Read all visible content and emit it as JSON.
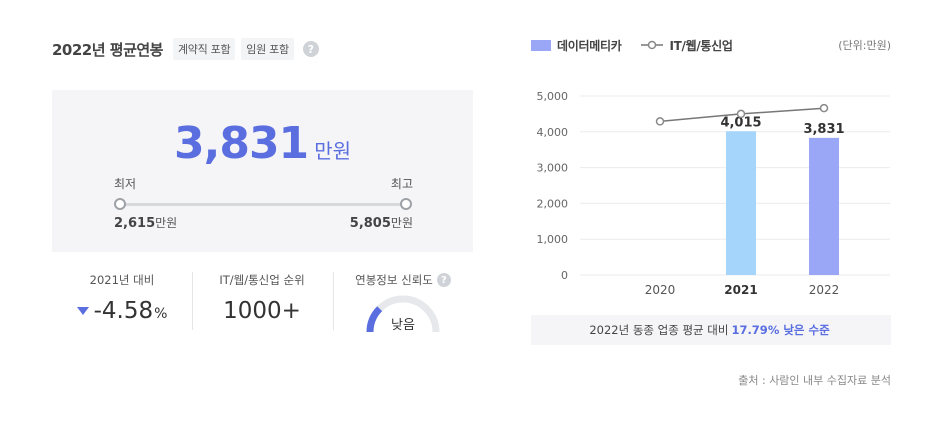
{
  "header": {
    "title": "2022년 평균연봉",
    "tags": [
      "계약직 포함",
      "임원 포함"
    ],
    "help_icon": "question-circle-icon"
  },
  "salary": {
    "average": "3,831",
    "unit": "만원",
    "min_label": "최저",
    "max_label": "최고",
    "min_value": "2,615",
    "max_value": "5,805",
    "value_unit": "만원"
  },
  "stats": {
    "yoy": {
      "label": "2021년 대비",
      "value": "-4.58",
      "unit": "%",
      "icon": "down-triangle-icon"
    },
    "rank": {
      "label": "IT/웹/통신업 순위",
      "value": "1000+"
    },
    "reliability": {
      "label": "연봉정보 신뢰도",
      "value": "낮음",
      "level": 0.25
    }
  },
  "legend": {
    "company": "데이터메티카",
    "industry": "IT/웹/통신업",
    "unit_note": "(단위:만원)"
  },
  "chart_data": {
    "type": "bar",
    "categories": [
      "2020",
      "2021",
      "2022"
    ],
    "series": [
      {
        "name": "데이터메티카",
        "kind": "bar",
        "values": [
          null,
          4015,
          3831
        ],
        "labels": [
          "",
          "4,015",
          "3,831"
        ]
      },
      {
        "name": "IT/웹/통신업",
        "kind": "line",
        "values": [
          4290,
          4500,
          4660
        ]
      }
    ],
    "ylim": [
      0,
      5000
    ],
    "yticks": [
      "0",
      "1,000",
      "2,000",
      "3,000",
      "4,000",
      "5,000"
    ],
    "ytick_values": [
      0,
      1000,
      2000,
      3000,
      4000,
      5000
    ],
    "bold_categories": [
      "2021"
    ],
    "colors": {
      "bar_2021": "#a6d5fb",
      "bar_2022": "#9aa7f7",
      "line": "#777777",
      "grid": "#e9ebee"
    }
  },
  "compare": {
    "prefix": "2022년 동종 업종 평균 대비",
    "highlight": "17.79% 낮은 수준"
  },
  "source": "출처 : 사람인 내부 수집자료 분석",
  "colors": {
    "accent": "#5a6ee0",
    "box_bg": "#f5f5f7"
  }
}
